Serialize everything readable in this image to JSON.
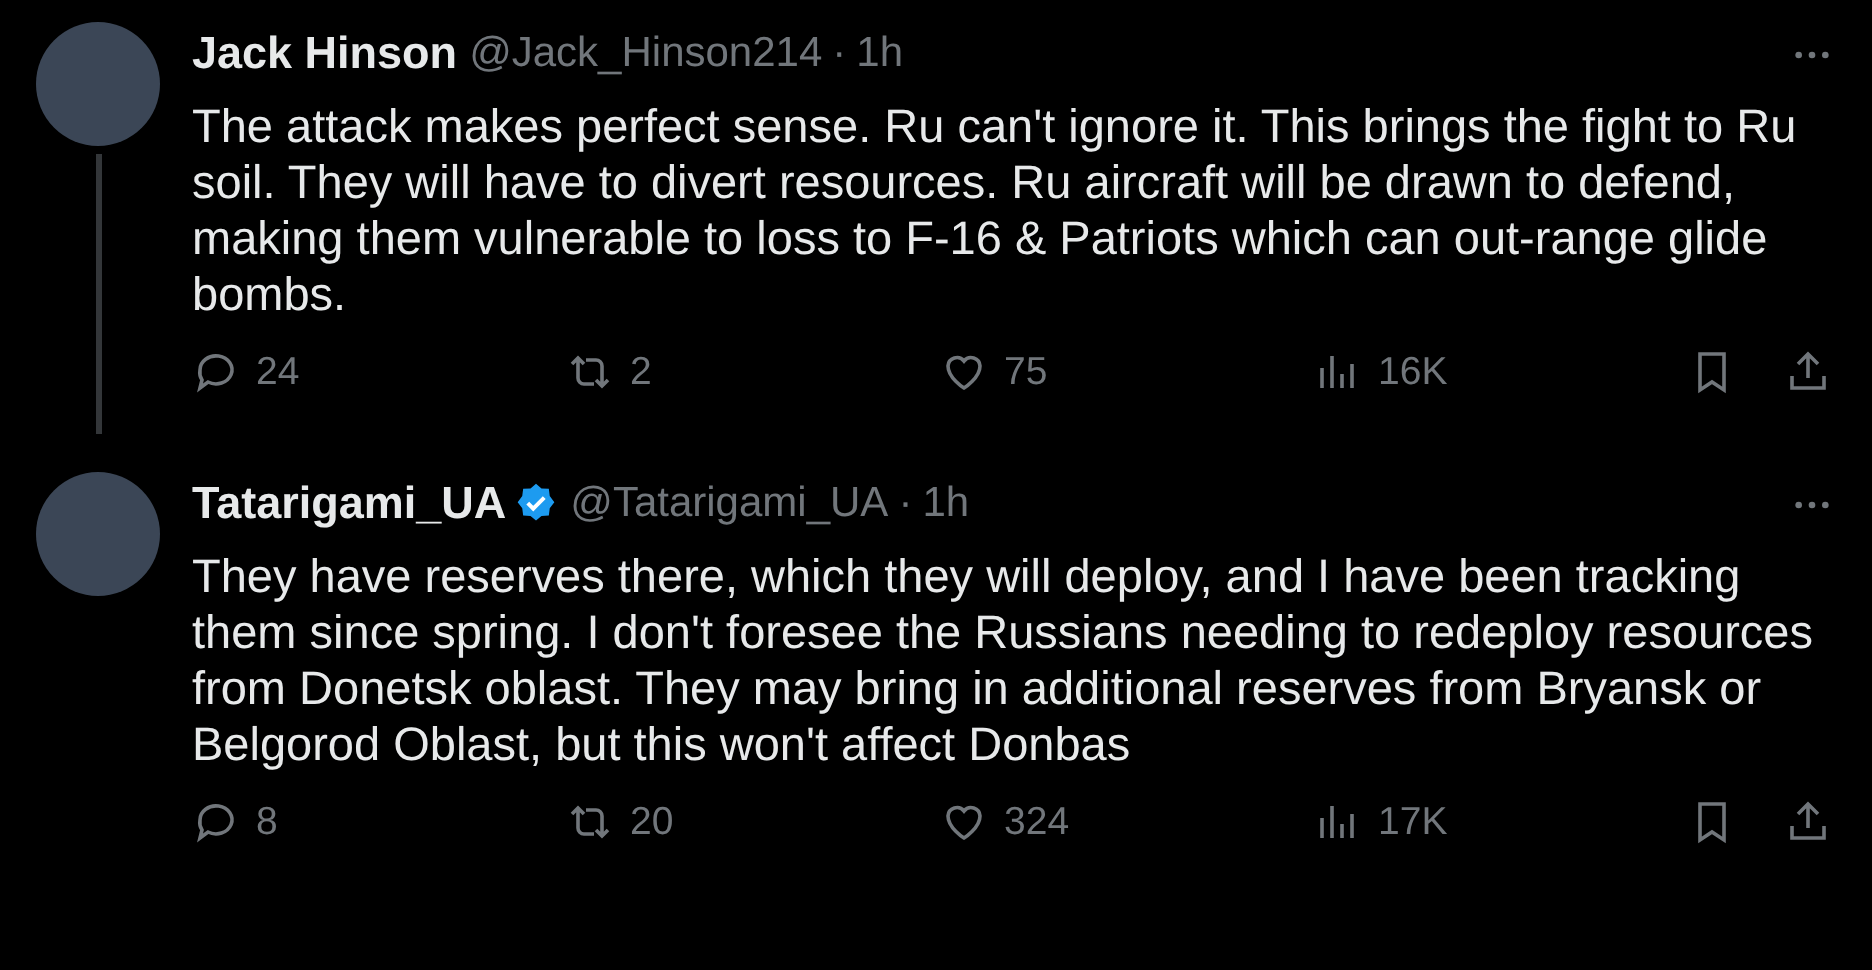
{
  "tweets": [
    {
      "author": "Jack Hinson",
      "handle": "@Jack_Hinson214",
      "separator": "·",
      "time": "1h",
      "verified": false,
      "thread_continues": true,
      "text": "The attack makes perfect sense. Ru can't ignore it. This brings the fight to Ru soil. They will have to divert resources. Ru aircraft will be drawn to defend, making them vulnerable to loss to F-16 & Patriots which can out-range glide bombs.",
      "replies": "24",
      "reposts": "2",
      "likes": "75",
      "views": "16K"
    },
    {
      "author": "Tatarigami_UA",
      "handle": "@Tatarigami_UA",
      "separator": "·",
      "time": "1h",
      "verified": true,
      "thread_continues": false,
      "text": "They have reserves there, which they will deploy, and I have been tracking them since spring. I don't foresee the Russians needing to redeploy resources from Donetsk oblast. They may bring in additional reserves from Bryansk or Belgorod Oblast, but this won't affect Donbas",
      "replies": "8",
      "reposts": "20",
      "likes": "324",
      "views": "17K"
    }
  ]
}
